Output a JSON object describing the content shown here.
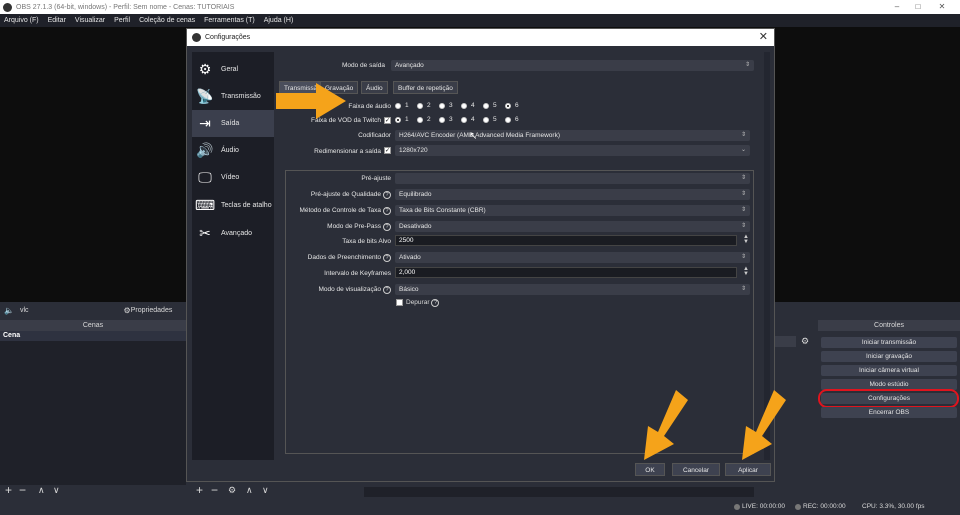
{
  "window": {
    "title": "OBS 27.1.3 (64-bit, windows) - Perfil: Sem nome - Cenas: TUTORIAIS"
  },
  "menu": [
    "Arquivo (F)",
    "Editar",
    "Visualizar",
    "Perfil",
    "Coleção de cenas",
    "Ferramentas (T)",
    "Ajuda (H)"
  ],
  "context": {
    "source": "vlc",
    "properties": "Propriedades"
  },
  "scenes": {
    "title": "Cenas",
    "items": [
      "Cena"
    ]
  },
  "controls": {
    "title": "Controles",
    "buttons": [
      "Iniciar transmissão",
      "Iniciar gravação",
      "Iniciar câmera virtual",
      "Modo estúdio",
      "Configurações",
      "Encerrar OBS"
    ]
  },
  "status": {
    "live": "LIVE: 00:00:00",
    "rec": "REC: 00:00:00",
    "cpu": "CPU: 3.3%, 30.00 fps"
  },
  "dialog": {
    "title": "Configurações",
    "sidebar": [
      "Geral",
      "Transmissão",
      "Saída",
      "Áudio",
      "Vídeo",
      "Teclas de atalho",
      "Avançado"
    ],
    "output_mode_label": "Modo de saída",
    "output_mode": "Avançado",
    "tabs": [
      "Transmissão",
      "Gravação",
      "Áudio",
      "Buffer de repetição"
    ],
    "audio_track_label": "Faixa de áudio",
    "vod_label": "Faixa de VOD da Twitch",
    "tracks": [
      "1",
      "2",
      "3",
      "4",
      "5",
      "6"
    ],
    "encoder_label": "Codificador",
    "encoder": "H264/AVC Encoder (AMD Advanced Media Framework)",
    "rescale_label": "Redimensionar a saída",
    "rescale": "1280x720",
    "preset_label": "Pré-ajuste",
    "preset": "",
    "quality_label": "Pré-ajuste de Qualidade",
    "quality": "Equilibrado",
    "ratecontrol_label": "Método de Controle de Taxa",
    "ratecontrol": "Taxa de Bits Constante (CBR)",
    "prepass_label": "Modo de Pre-Pass",
    "prepass": "Desativado",
    "bitrate_label": "Taxa de bits Alvo",
    "bitrate": "2500",
    "filler_label": "Dados de Preenchimento",
    "filler": "Ativado",
    "keyframe_label": "Intervalo de Keyframes",
    "keyframe": "2,000",
    "view_label": "Modo de visualização",
    "view": "Básico",
    "debug_label": "Depurar",
    "ok": "OK",
    "cancel": "Cancelar",
    "apply": "Aplicar"
  },
  "colors": {
    "arrow": "#f5a31a",
    "highlight": "#e0141e"
  }
}
